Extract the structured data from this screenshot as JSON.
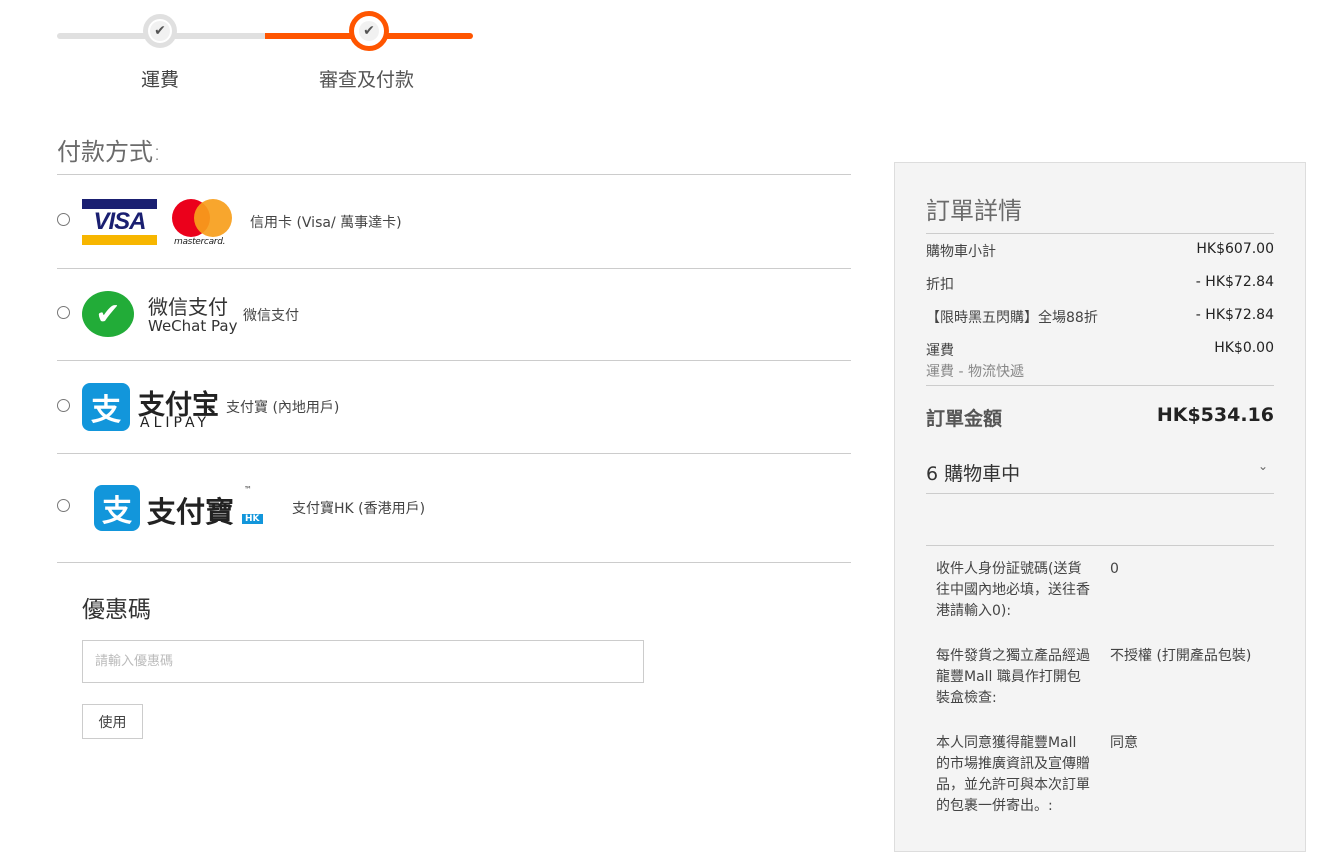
{
  "progress": {
    "steps": [
      {
        "label": "運費",
        "state": "done"
      },
      {
        "label": "審查及付款",
        "state": "active"
      }
    ],
    "accent_color": "#ff5500"
  },
  "payment": {
    "title": "付款方式:",
    "methods": [
      {
        "label": "信用卡 (Visa/ 萬事達卡)",
        "logos": [
          "visa-logo",
          "mastercard-logo"
        ],
        "visa_text": "VISA",
        "mastercard_text": "mastercard."
      },
      {
        "label": "微信支付",
        "logo_cn": "微信支付",
        "logo_en": "WeChat Pay"
      },
      {
        "label": "支付寶 (內地用戶)",
        "logo_cn": "支付宝",
        "logo_en": "ALIPAY"
      },
      {
        "label": "支付寶HK (香港用戶)",
        "logo_cn": "支付寶",
        "logo_tm": "™",
        "logo_badge": "HK"
      }
    ]
  },
  "coupon": {
    "title": "優惠碼",
    "placeholder": "請輸入優惠碼",
    "value": "",
    "button_label": "使用"
  },
  "summary": {
    "title": "訂單詳情",
    "rows": [
      {
        "label": "購物車小計",
        "value": "HK$607.00"
      },
      {
        "label": "折扣",
        "value": "- HK$72.84"
      },
      {
        "label": "【限時黑五閃購】全場88折",
        "value": "- HK$72.84"
      },
      {
        "label": "運費",
        "value": "HK$0.00"
      }
    ],
    "shipping_sub": "運費 - 物流快遞",
    "total_label": "訂單金額",
    "total_value": "HK$534.16",
    "cart_label": "6 購物車中",
    "info": [
      {
        "question": "收件人身份証號碼(送貨往中國內地必填，送往香港請輸入0):",
        "answer": "0"
      },
      {
        "question": "每件發貨之獨立產品經過龍豐Mall 職員作打開包裝盒檢查:",
        "answer": "不授權 (打開產品包裝)"
      },
      {
        "question": "本人同意獲得龍豐Mall 的市場推廣資訊及宣傳贈品，並允許可與本次訂單的包裹一併寄出。:",
        "answer": "同意"
      }
    ]
  }
}
